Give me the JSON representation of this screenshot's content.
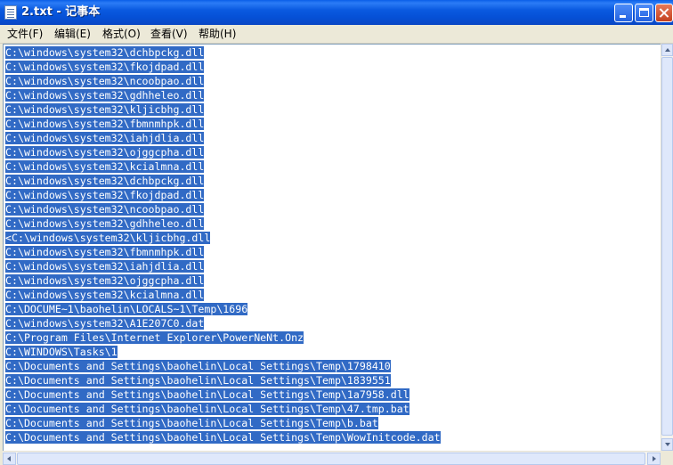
{
  "window": {
    "title": "2.txt - 记事本"
  },
  "menu": [
    {
      "label": "文件(F)"
    },
    {
      "label": "编辑(E)"
    },
    {
      "label": "格式(O)"
    },
    {
      "label": "查看(V)"
    },
    {
      "label": "帮助(H)"
    }
  ],
  "editor": {
    "lines": [
      "C:\\windows\\system32\\dchbpckg.dll",
      "C:\\windows\\system32\\fkojdpad.dll",
      "C:\\windows\\system32\\ncoobpao.dll",
      "C:\\windows\\system32\\gdhheleo.dll",
      "C:\\windows\\system32\\kljicbhg.dll",
      "C:\\windows\\system32\\fbmnmhpk.dll",
      "C:\\windows\\system32\\iahjdlia.dll",
      "C:\\windows\\system32\\ojggcpha.dll",
      "C:\\windows\\system32\\kcialmna.dll",
      "C:\\windows\\system32\\dchbpckg.dll",
      "C:\\windows\\system32\\fkojdpad.dll",
      "C:\\windows\\system32\\ncoobpao.dll",
      "C:\\windows\\system32\\gdhheleo.dll",
      "<C:\\windows\\system32\\kljicbhg.dll",
      "C:\\windows\\system32\\fbmnmhpk.dll",
      "C:\\windows\\system32\\iahjdlia.dll",
      "C:\\windows\\system32\\ojggcpha.dll",
      "C:\\windows\\system32\\kcialmna.dll",
      "C:\\DOCUME~1\\baohelin\\LOCALS~1\\Temp\\1696",
      "C:\\windows\\system32\\A1E207C0.dat",
      "C:\\Program Files\\Internet Explorer\\PowerNeNt.Onz",
      "C:\\WINDOWS\\Tasks\\1",
      "C:\\Documents and Settings\\baohelin\\Local Settings\\Temp\\1798410",
      "C:\\Documents and Settings\\baohelin\\Local Settings\\Temp\\1839551",
      "C:\\Documents and Settings\\baohelin\\Local Settings\\Temp\\1a7958.dll",
      "C:\\Documents and Settings\\baohelin\\Local Settings\\Temp\\47.tmp.bat",
      "C:\\Documents and Settings\\baohelin\\Local Settings\\Temp\\b.bat",
      "C:\\Documents and Settings\\baohelin\\Local Settings\\Temp\\WowInitcode.dat"
    ]
  },
  "colors": {
    "selection": "#316ac5",
    "titlebar": "#0a5ae0",
    "chrome": "#ece9d8"
  }
}
